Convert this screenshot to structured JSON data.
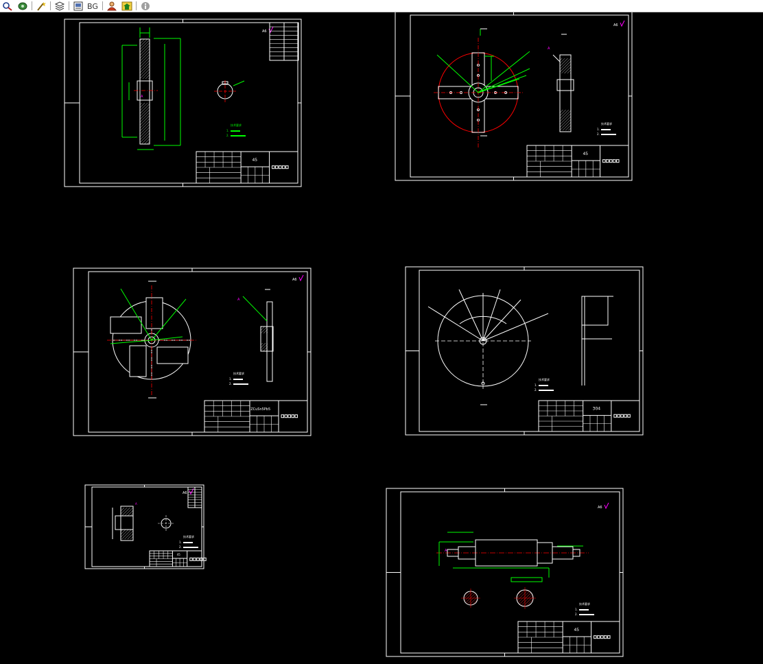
{
  "toolbar": {
    "buttons": [
      {
        "name": "zoom-icon",
        "label": ""
      },
      {
        "name": "pan-icon",
        "label": ""
      },
      {
        "name": "wand-icon",
        "label": ""
      },
      {
        "name": "layers-icon",
        "label": ""
      },
      {
        "name": "print-icon",
        "label": ""
      },
      {
        "name": "bg-icon",
        "label": "BG"
      },
      {
        "name": "user-icon",
        "label": ""
      },
      {
        "name": "home-icon",
        "label": ""
      },
      {
        "name": "info-icon",
        "label": ""
      }
    ]
  },
  "sheets": [
    {
      "id": "sheet-1",
      "material": "45",
      "roughness": "A6",
      "note_title": "技术要求"
    },
    {
      "id": "sheet-2",
      "material": "45",
      "roughness": "A6",
      "note_title": "技术要求"
    },
    {
      "id": "sheet-3",
      "material": "ZCuSn5Pb5",
      "roughness": "A6",
      "note_title": "技术要求"
    },
    {
      "id": "sheet-4",
      "material": "304",
      "roughness": "",
      "note_title": "技术要求"
    },
    {
      "id": "sheet-5",
      "material": "45",
      "roughness": "A6",
      "note_title": "技术要求"
    },
    {
      "id": "sheet-6",
      "material": "45",
      "roughness": "A6",
      "note_title": "技术要求"
    }
  ],
  "colors": {
    "background": "#000000",
    "frame": "#ffffff",
    "dimension": "#00ff00",
    "centerline": "#ff0000",
    "roughness": "#ff00ff",
    "outline": "#ffffff"
  }
}
